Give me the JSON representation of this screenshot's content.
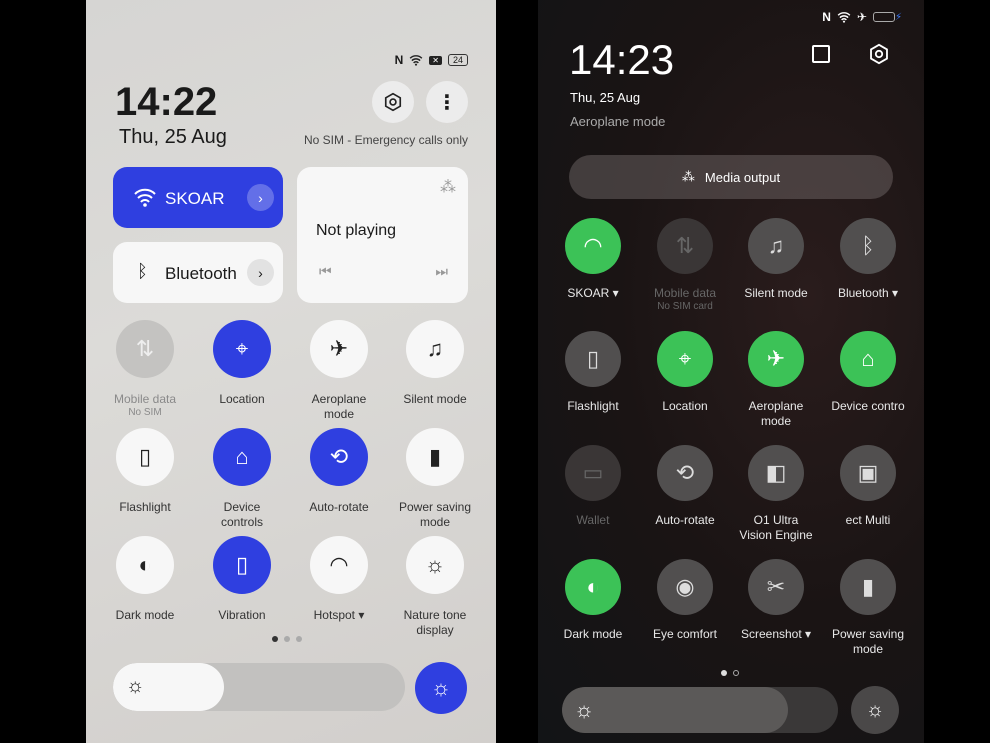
{
  "left": {
    "status": {
      "icons": [
        "nfc-icon",
        "wifi-icon",
        "no-sim-icon"
      ],
      "battery": "24"
    },
    "time": "14:22",
    "date": "Thu, 25 Aug",
    "sim_status": "No SIM - Emergency calls only",
    "header_buttons": [
      {
        "icon": "settings-icon"
      },
      {
        "icon": "more-icon"
      }
    ],
    "wifi_card": {
      "label": "SKOAR",
      "accent": "#2f3fe0"
    },
    "bluetooth_card": {
      "label": "Bluetooth"
    },
    "media_card": {
      "title": "Not playing",
      "icons": [
        "media-output-icon",
        "previous-icon",
        "next-icon"
      ]
    },
    "tiles": [
      {
        "label": "Mobile data",
        "sub": "No SIM",
        "icon": "mobile-data",
        "state": "disabled"
      },
      {
        "label": "Location",
        "icon": "location",
        "state": "on"
      },
      {
        "label": "Aeroplane\nmode",
        "icon": "airplane",
        "state": "off"
      },
      {
        "label": "Silent mode",
        "icon": "bell",
        "state": "off"
      },
      {
        "label": "Flashlight",
        "icon": "flashlight",
        "state": "off"
      },
      {
        "label": "Device\ncontrols",
        "icon": "home",
        "state": "on"
      },
      {
        "label": "Auto-rotate",
        "icon": "rotate",
        "state": "on"
      },
      {
        "label": "Power saving\nmode",
        "icon": "battery",
        "state": "off"
      },
      {
        "label": "Dark mode",
        "icon": "dark-mode",
        "state": "off"
      },
      {
        "label": "Vibration",
        "icon": "vibration",
        "state": "on"
      },
      {
        "label": "Hotspot ▾",
        "icon": "hotspot",
        "state": "off"
      },
      {
        "label": "Nature tone\ndisplay",
        "icon": "nature-tone",
        "state": "off"
      }
    ],
    "page": {
      "current": 1,
      "total": 3
    },
    "brightness": {
      "level": 0.38,
      "auto_icon": "auto-brightness-icon"
    }
  },
  "right": {
    "status": {
      "icons": [
        "nfc-icon",
        "wifi-icon",
        "airplane-icon",
        "battery-charging-icon"
      ]
    },
    "time": "14:23",
    "date": "Thu, 25 Aug",
    "mode": "Aeroplane mode",
    "header_buttons": [
      {
        "icon": "edit-icon"
      },
      {
        "icon": "settings-icon"
      }
    ],
    "media_output": "Media output",
    "accent": "#3cc257",
    "tiles": [
      {
        "label": "SKOAR ▾",
        "icon": "wifi",
        "state": "on"
      },
      {
        "label": "Mobile data",
        "sub": "No SIM card",
        "icon": "mobile-data",
        "state": "disabled"
      },
      {
        "label": "Silent mode",
        "icon": "bell",
        "state": "off"
      },
      {
        "label": "Bluetooth ▾",
        "icon": "bluetooth",
        "state": "off"
      },
      {
        "label": "Flashlight",
        "icon": "flashlight",
        "state": "off"
      },
      {
        "label": "Location",
        "icon": "location",
        "state": "on"
      },
      {
        "label": "Aeroplane\nmode",
        "icon": "airplane",
        "state": "on"
      },
      {
        "label": "Device contro",
        "icon": "home",
        "state": "on"
      },
      {
        "label": "Wallet",
        "icon": "wallet",
        "state": "disabled"
      },
      {
        "label": "Auto-rotate",
        "icon": "rotate",
        "state": "off"
      },
      {
        "label": "O1 Ultra\nVision Engine",
        "icon": "vision",
        "state": "off"
      },
      {
        "label": "ect      Multi",
        "icon": "multi-screen",
        "state": "off"
      },
      {
        "label": "Dark mode",
        "icon": "dark-mode",
        "state": "on"
      },
      {
        "label": "Eye comfort",
        "icon": "eye",
        "state": "off"
      },
      {
        "label": "Screenshot ▾",
        "icon": "screenshot",
        "state": "off"
      },
      {
        "label": "Power saving\nmode",
        "icon": "battery",
        "state": "off"
      }
    ],
    "page": {
      "current": 1,
      "total": 2
    },
    "brightness": {
      "level": 0.82,
      "auto_icon": "auto-brightness-icon"
    }
  }
}
